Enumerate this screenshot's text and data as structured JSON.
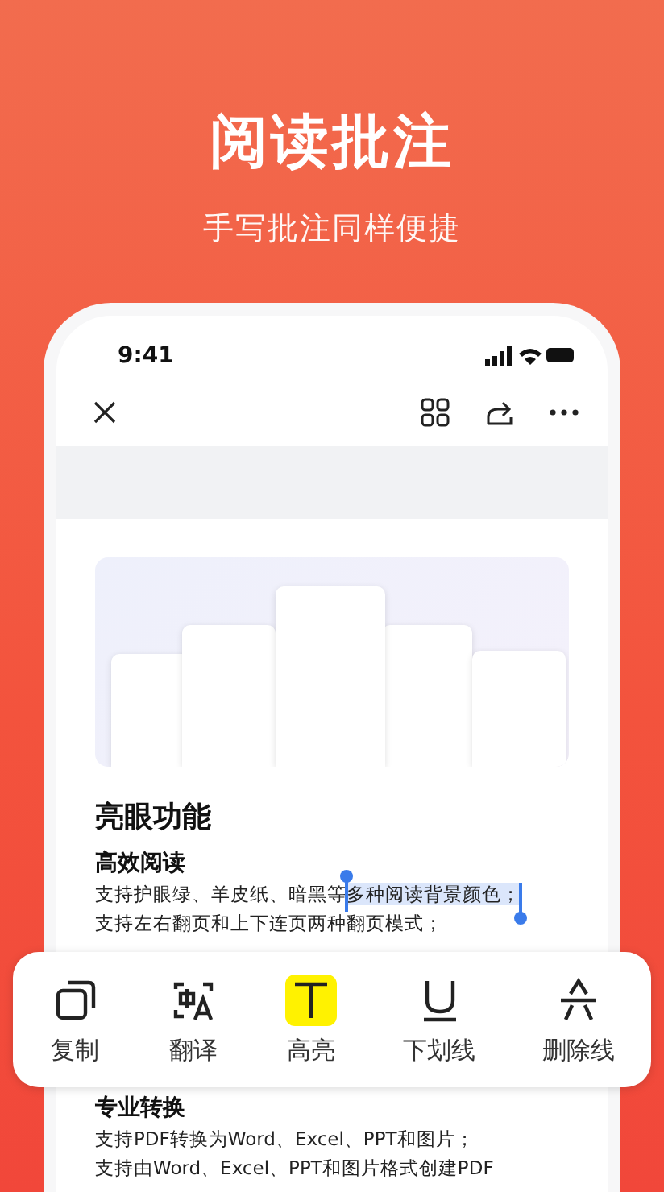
{
  "headline": "阅读批注",
  "subheadline": "手写批注同样便捷",
  "status_bar": {
    "time": "9:41"
  },
  "document": {
    "heading": "亮眼功能",
    "sections": [
      {
        "title": "高效阅读",
        "lines": [
          {
            "before": "支持护眼绿、羊皮纸、暗黑等",
            "selected_text": "多种阅读背景颜色；"
          },
          {
            "before": "支持左右翻页和上下连页两种翻页模式；"
          }
        ]
      },
      {
        "title": "专业转换",
        "lines": [
          {
            "before": "支持PDF转换为Word、Excel、PPT和图片；"
          },
          {
            "before": "支持由Word、Excel、PPT和图片格式创建PDF"
          }
        ]
      }
    ]
  },
  "selection_toolbar": [
    {
      "kind": "copy",
      "label": "复制",
      "selected": false
    },
    {
      "kind": "translate",
      "label": "翻译",
      "selected": false
    },
    {
      "kind": "highlight",
      "label": "高亮",
      "selected": true
    },
    {
      "kind": "underline",
      "label": "下划线",
      "selected": false
    },
    {
      "kind": "strike",
      "label": "删除线",
      "selected": false
    }
  ]
}
